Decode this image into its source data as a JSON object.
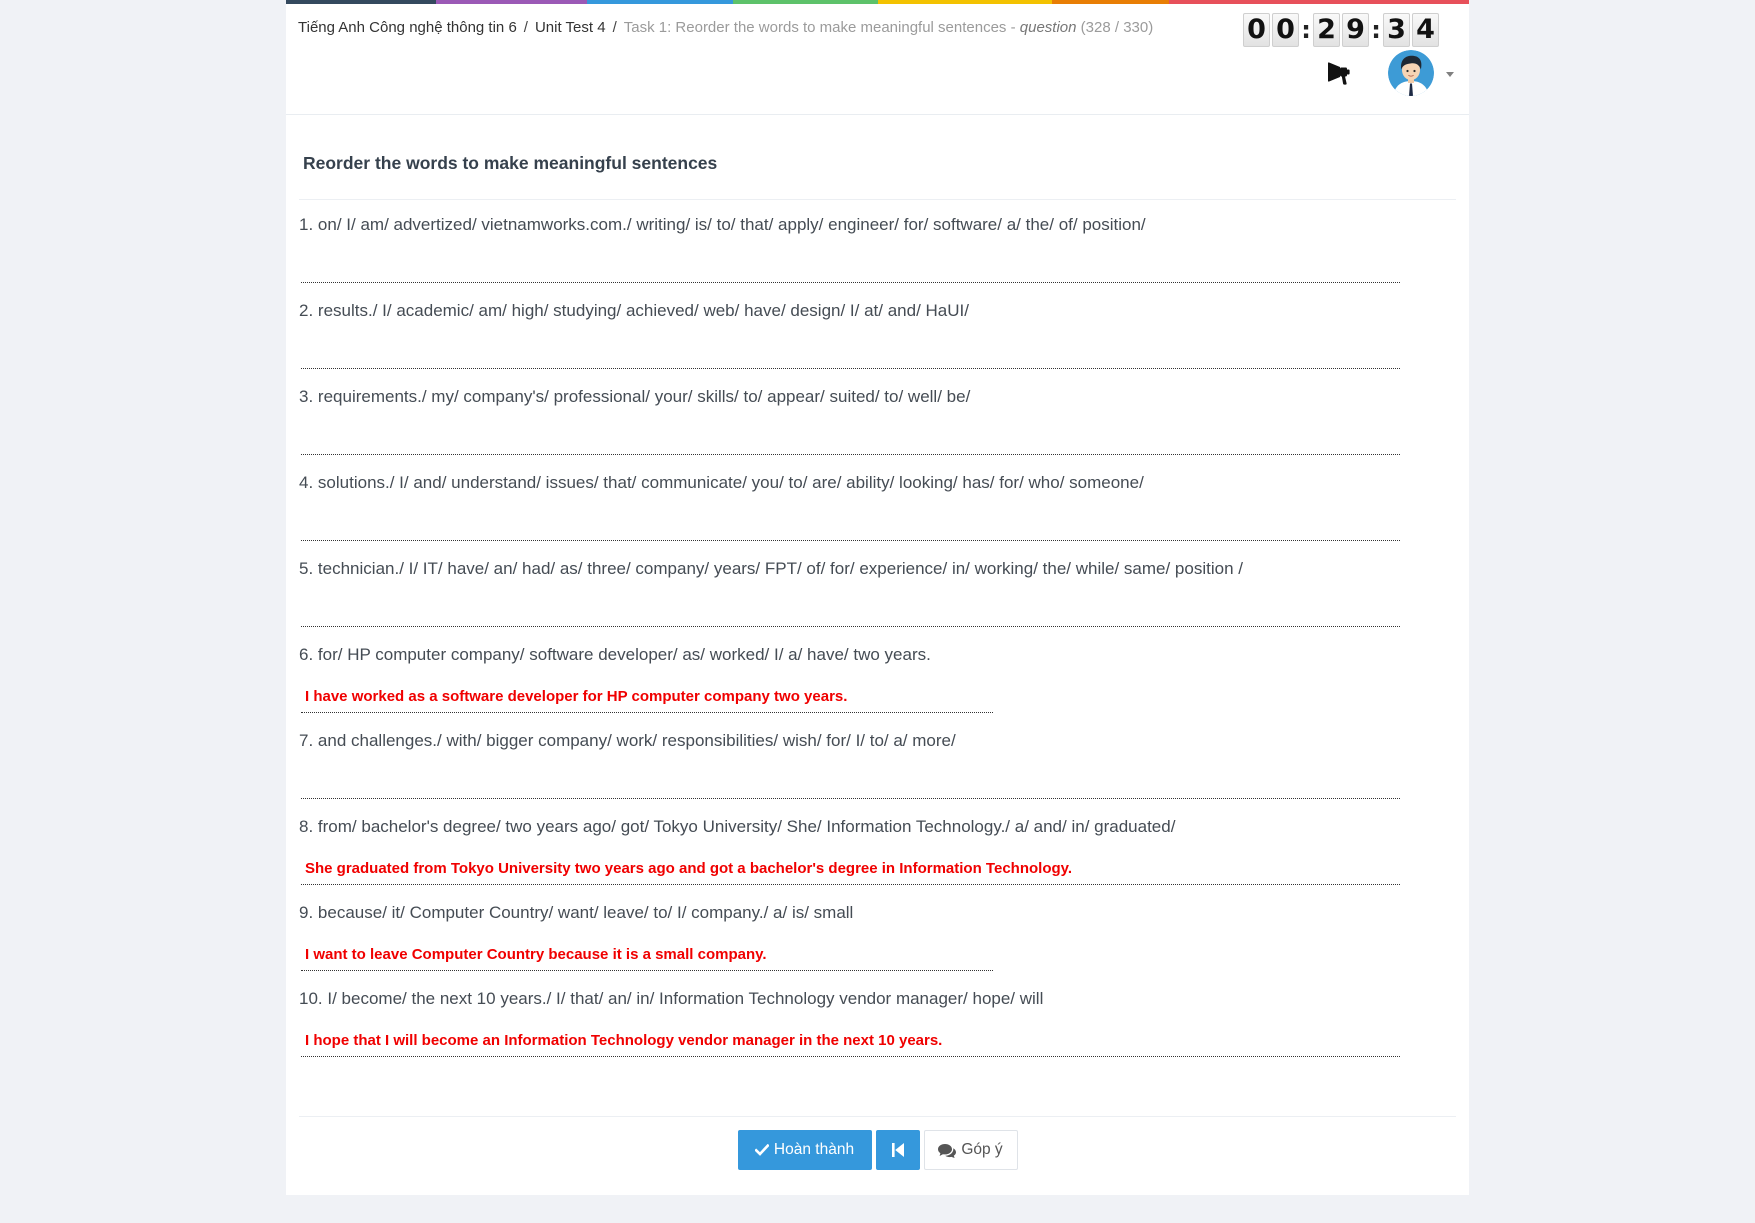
{
  "theme": {
    "primary": "#3598dc",
    "answer": "#f00000",
    "stripe": [
      "#34495e",
      "#9b59b6",
      "#3598dc",
      "#5dc26a",
      "#f3c200",
      "#e87e04",
      "#e7505a"
    ]
  },
  "breadcrumb": {
    "items": [
      "Tiếng Anh Công nghệ thông tin 6",
      "Unit Test 4"
    ],
    "separator": "/",
    "current": {
      "task": "Task 1: Reorder the words to make meaningful sentences -",
      "type": "question",
      "progress": "(328 / 330)"
    }
  },
  "timer": {
    "hours": [
      "0",
      "0"
    ],
    "minutes": [
      "2",
      "9"
    ],
    "seconds": [
      "3",
      "4"
    ],
    "separator": ":"
  },
  "header": {
    "notification_icon": "bullhorn-icon",
    "avatar_icon": "user-avatar-icon",
    "menu_icon": "caret-down-icon"
  },
  "task": {
    "title": "Reorder the words to make meaningful sentences",
    "questions": [
      {
        "number": "1.",
        "prompt": "on/ I/ am/ advertized/ vietnamworks.com./ writing/ is/ to/ that/ apply/ engineer/ for/ software/ a/ the/ of/ position/",
        "answer": ""
      },
      {
        "number": "2.",
        "prompt": "results./ I/ academic/ am/ high/ studying/ achieved/ web/ have/ design/ I/ at/ and/ HaUI/",
        "answer": ""
      },
      {
        "number": "3.",
        "prompt": "requirements./ my/ company's/ professional/ your/ skills/ to/ appear/ suited/ to/ well/ be/",
        "answer": ""
      },
      {
        "number": "4.",
        "prompt": "solutions./ I/ and/ understand/ issues/ that/ communicate/ you/ to/ are/ ability/ looking/ has/ for/ who/ someone/",
        "answer": ""
      },
      {
        "number": "5.",
        "prompt": "technician./ I/ IT/ have/ an/ had/ as/ three/ company/ years/ FPT/ of/ for/ experience/ in/ working/ the/ while/ same/ position /",
        "answer": ""
      },
      {
        "number": "6.",
        "prompt": "for/ HP computer company/ software developer/ as/ worked/ I/ a/ have/ two years.",
        "answer": "I have worked as a software developer for HP computer company two years."
      },
      {
        "number": "7.",
        "prompt": "and challenges./ with/ bigger company/ work/ responsibilities/ wish/ for/ I/ to/ a/ more/",
        "answer": ""
      },
      {
        "number": "8.",
        "prompt": "from/ bachelor's degree/ two years ago/ got/ Tokyo University/ She/ Information Technology./ a/ and/ in/ graduated/",
        "answer": "She graduated from Tokyo University two years ago and got a bachelor's degree in Information Technology."
      },
      {
        "number": "9.",
        "prompt": "because/ it/ Computer Country/ want/ leave/ to/ I/ company./ a/ is/ small",
        "answer": "I want to leave Computer Country because it is a small company."
      },
      {
        "number": "10.",
        "prompt": "I/ become/ the next 10 years./ I/ that/ an/ in/ Information Technology vendor manager/ hope/ will",
        "answer": "I hope that I will become an Information Technology vendor manager in the next 10 years."
      }
    ]
  },
  "actions": {
    "finish": {
      "label": "Hoàn thành",
      "icon": "check-icon"
    },
    "back": {
      "icon": "step-backward-icon"
    },
    "feedback": {
      "label": "Góp ý",
      "icon": "comments-icon"
    }
  }
}
